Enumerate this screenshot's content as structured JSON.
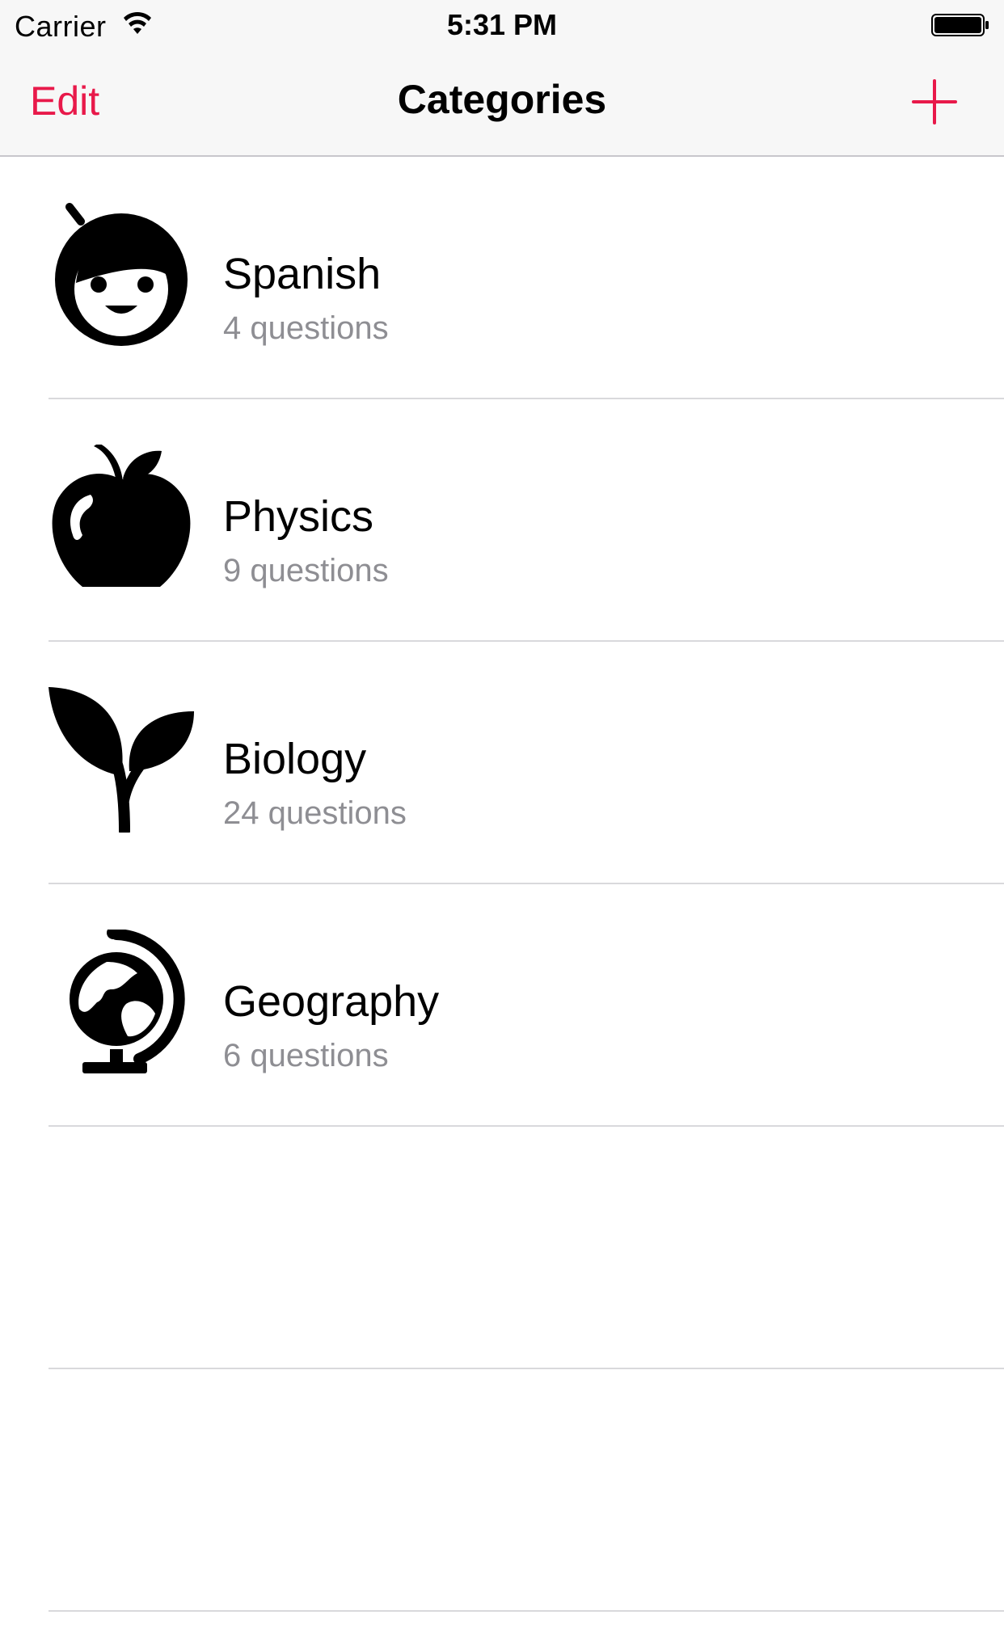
{
  "status_bar": {
    "carrier": "Carrier",
    "time": "5:31 PM",
    "wifi_icon": "wifi-icon",
    "battery_icon": "battery-icon"
  },
  "nav_bar": {
    "edit_label": "Edit",
    "title": "Categories",
    "add_icon": "plus-icon",
    "accent_color": "#e8194a"
  },
  "categories": [
    {
      "title": "Spanish",
      "subtitle": "4 questions",
      "icon": "child-face-icon"
    },
    {
      "title": "Physics",
      "subtitle": "9 questions",
      "icon": "apple-icon"
    },
    {
      "title": "Biology",
      "subtitle": "24 questions",
      "icon": "sprout-icon"
    },
    {
      "title": "Geography",
      "subtitle": "6 questions",
      "icon": "globe-icon"
    }
  ]
}
